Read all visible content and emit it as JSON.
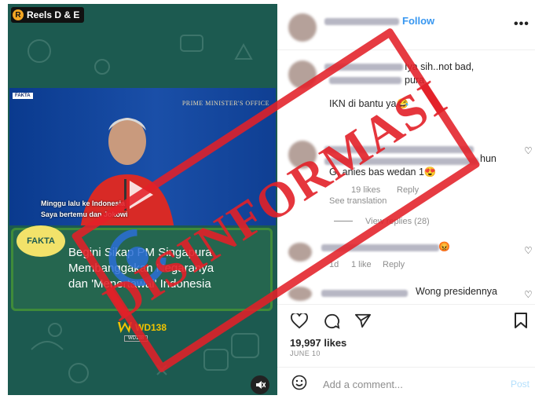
{
  "media": {
    "reel_tag": "Reels D & E",
    "reel_badge": "R",
    "video": {
      "source_badge": "FAKTA",
      "office_caption": "PRIME MINISTER'S OFFICE",
      "subtitle_line1": "Minggu lalu",
      "subtitle_line2": "Saya bertemu",
      "subtitle_line1_tail": "ke Indonesia",
      "subtitle_line2_tail": "dan Jokowi"
    },
    "banner": {
      "logo_text": "FAKTA",
      "line1": "Begini Sikap PM Singapura",
      "line2": "Membanggakan Negaranya",
      "line3": "dan 'Menertawai' Indonesia"
    },
    "brand": "WD138",
    "brand_small": "WD138"
  },
  "side": {
    "follow_label": "Follow",
    "more_label": "•••",
    "comments": [
      {
        "text1": "Iya sih..not bad,",
        "text2": "pura",
        "text3": "IKN di bantu ya😂"
      },
      {
        "text1": "hun",
        "text2": "G, anies bas wedan 1😍",
        "likes": "19 likes",
        "reply": "Reply",
        "translation": "See translation",
        "view_replies": "View replies (28)"
      },
      {
        "time": "1d",
        "likes": "1 like",
        "reply": "Reply"
      },
      {
        "text1": "Wong presidennya"
      }
    ],
    "likes_count": "19,997 likes",
    "date": "JUNE 10",
    "add_comment_placeholder": "Add a comment...",
    "post_label": "Post"
  },
  "stamp": {
    "text": "DISINFORMASI",
    "color": "#e22028"
  },
  "icons": [
    "heart-icon",
    "comment-icon",
    "share-icon",
    "bookmark-icon",
    "emoji-icon",
    "mute-icon",
    "play-icon"
  ]
}
